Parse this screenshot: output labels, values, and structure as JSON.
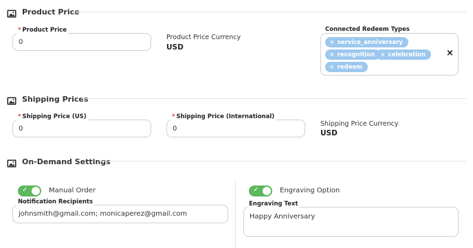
{
  "sections": {
    "product_price": "Product Price",
    "shipping_prices": "Shipping Prices",
    "on_demand": "On-Demand Settings"
  },
  "product_price": {
    "label": "Product Price",
    "required": "*",
    "value": "0",
    "currency_label": "Product Price Currency",
    "currency_value": "USD"
  },
  "redeem_types": {
    "label": "Connected Redeem Types",
    "chips": [
      "service_anniversary",
      "recognition",
      "celebration",
      "redeem"
    ],
    "chip_remove": "×",
    "clear": "×"
  },
  "shipping": {
    "us_label": "Shipping Price (US)",
    "us_value": "0",
    "intl_label": "Shipping Price (International)",
    "intl_value": "0",
    "required": "*",
    "currency_label": "Shipping Price Currency",
    "currency_value": "USD"
  },
  "on_demand": {
    "manual_order_label": "Manual Order",
    "manual_order_on": true,
    "recipients_label": "Notification Recipients",
    "recipients_value": "johnsmith@gmail.com; monicaperez@gmail.com",
    "engraving_label": "Engraving Option",
    "engraving_on": true,
    "engraving_text_label": "Engraving Text",
    "engraving_text_value": "Happy Anniversary"
  },
  "icons": {
    "section": "image-icon",
    "toggle_check": "✓"
  },
  "colors": {
    "toggle_on": "#5cb85c",
    "chip_bg": "#9cc7ee",
    "required": "#e53935"
  }
}
